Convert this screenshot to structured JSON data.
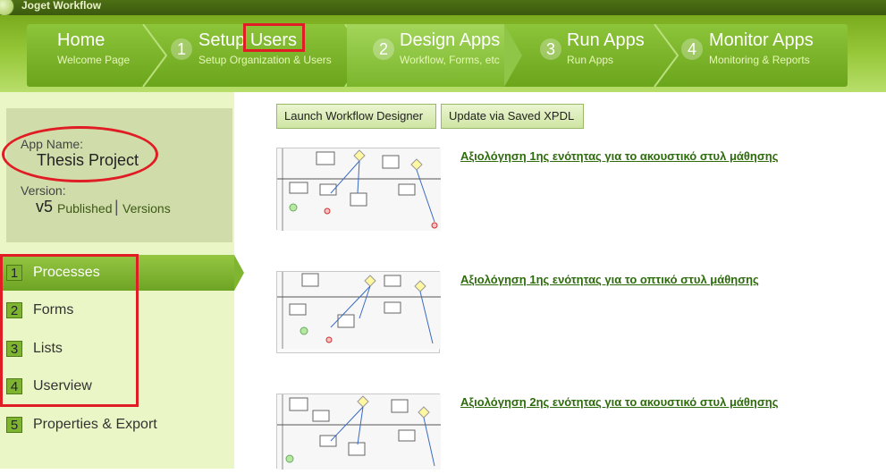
{
  "app": {
    "title": "Joget Workflow"
  },
  "nav": {
    "steps": [
      {
        "num": "",
        "title": "Home",
        "subtitle": "Welcome Page"
      },
      {
        "num": "1",
        "title": "Setup Users",
        "subtitle": "Setup Organization & Users"
      },
      {
        "num": "2",
        "title": "Design Apps",
        "subtitle": "Workflow, Forms, etc"
      },
      {
        "num": "3",
        "title": "Run Apps",
        "subtitle": "Run Apps"
      },
      {
        "num": "4",
        "title": "Monitor Apps",
        "subtitle": "Monitoring & Reports"
      }
    ]
  },
  "appinfo": {
    "app_name_label": "App Name:",
    "app_name": "Thesis Project",
    "version_label": "Version:",
    "version": "v5",
    "published": "Published",
    "separator": "|",
    "versions_link": "Versions"
  },
  "menu": {
    "items": [
      {
        "num": "1",
        "label": "Processes"
      },
      {
        "num": "2",
        "label": "Forms"
      },
      {
        "num": "3",
        "label": "Lists"
      },
      {
        "num": "4",
        "label": "Userview"
      },
      {
        "num": "5",
        "label": "Properties & Export"
      }
    ]
  },
  "toolbar": {
    "launch_designer": "Launch Workflow Designer",
    "update_xpdl": "Update via Saved XPDL"
  },
  "processes": [
    {
      "name": "Αξιολόγηση 1ης ενότητας για το ακουστικό στυλ μάθησης"
    },
    {
      "name": "Αξιολόγηση 1ης ενότητας για το οπτικό στυλ μάθησης"
    },
    {
      "name": "Αξιολόγηση 2ης ενότητας για το ακουστικό στυλ μάθησης"
    }
  ],
  "colors": {
    "accent": "#7ab62c",
    "annotation": "#e01c24",
    "link": "#2e6b0d"
  }
}
